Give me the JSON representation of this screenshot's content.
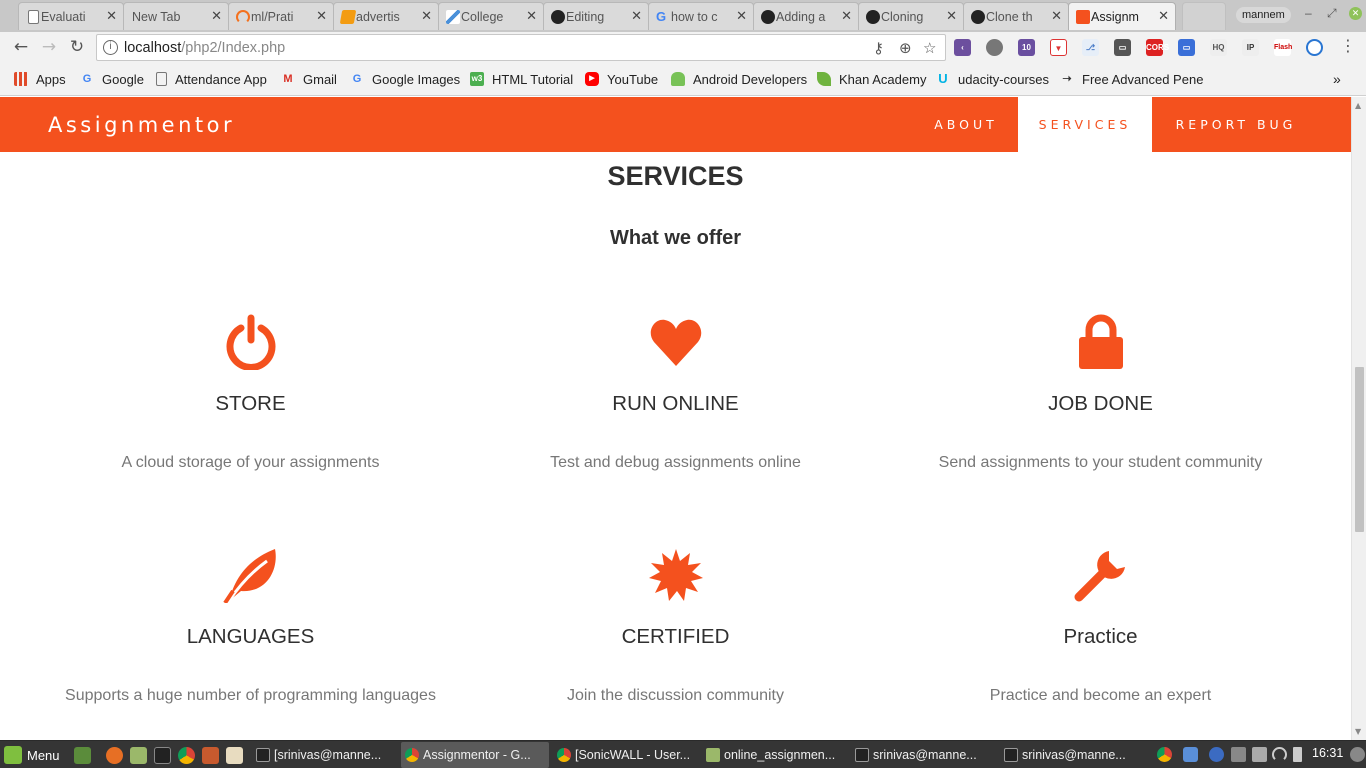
{
  "browser": {
    "tabs": [
      {
        "label": "Evaluati",
        "icon": "document-icon",
        "color": "#777777"
      },
      {
        "label": "New Tab",
        "icon": "none",
        "color": "#dadada"
      },
      {
        "label": "ml/Prati",
        "icon": "spinner-icon",
        "color": "#f4711e"
      },
      {
        "label": "advertis",
        "icon": "orange-doc-icon",
        "color": "#f39c12"
      },
      {
        "label": "College",
        "icon": "stripe-icon",
        "color": "#4a90d9"
      },
      {
        "label": "Editing",
        "icon": "github-icon",
        "color": "#222222"
      },
      {
        "label": "how to c",
        "icon": "google-icon",
        "color": "#4285f4"
      },
      {
        "label": "Adding a",
        "icon": "github-icon",
        "color": "#222222"
      },
      {
        "label": "Cloning",
        "icon": "github-icon",
        "color": "#222222"
      },
      {
        "label": "Clone th",
        "icon": "github-icon",
        "color": "#222222"
      },
      {
        "label": "Assignm",
        "icon": "xampp-icon",
        "color": "#f4511e",
        "active": true
      }
    ],
    "user_name": "mannem",
    "address": {
      "host": "localhost",
      "path": "/php2/Index.php"
    },
    "bookmarks": [
      {
        "label": "Apps",
        "icon": "apps-grid-icon",
        "color": "#e04b2a"
      },
      {
        "label": "Google",
        "icon": "google-icon",
        "color": "#4285f4"
      },
      {
        "label": "Attendance App",
        "icon": "document-icon",
        "color": "#777777"
      },
      {
        "label": "Gmail",
        "icon": "gmail-icon",
        "color": "#d93025"
      },
      {
        "label": "Google Images",
        "icon": "google-icon",
        "color": "#4285f4"
      },
      {
        "label": "HTML Tutorial",
        "icon": "w3-icon",
        "color": "#4caf50"
      },
      {
        "label": "YouTube",
        "icon": "youtube-icon",
        "color": "#ff0000"
      },
      {
        "label": "Android Developers",
        "icon": "android-icon",
        "color": "#78c257"
      },
      {
        "label": "Khan Academy",
        "icon": "leaf-icon",
        "color": "#6fb33f"
      },
      {
        "label": "udacity-courses",
        "icon": "udacity-icon",
        "color": "#02b3e4"
      },
      {
        "label": "Free Advanced Pene",
        "icon": "arrow-icon",
        "color": "#333333"
      }
    ]
  },
  "site": {
    "brand": "Assignmentor",
    "nav": [
      {
        "label": "ABOUT",
        "active": false
      },
      {
        "label": "SERVICES",
        "active": true
      },
      {
        "label": "REPORT BUG",
        "active": false
      }
    ],
    "section_title": "SERVICES",
    "section_subtitle": "What we offer",
    "services": [
      {
        "name": "STORE",
        "desc": "A cloud storage of your assignments",
        "icon": "power-icon"
      },
      {
        "name": "RUN ONLINE",
        "desc": "Test and debug assignments online",
        "icon": "heart-icon"
      },
      {
        "name": "JOB DONE",
        "desc": "Send assignments to your student community",
        "icon": "lock-icon"
      },
      {
        "name": "LANGUAGES",
        "desc": "Supports a huge number of programming languages",
        "icon": "leaf-icon"
      },
      {
        "name": "CERTIFIED",
        "desc": "Join the discussion community",
        "icon": "certificate-icon"
      },
      {
        "name": "Practice",
        "desc": "Practice and become an expert",
        "icon": "wrench-icon"
      }
    ],
    "accent_color": "#f4511e"
  },
  "taskbar": {
    "menu_label": "Menu",
    "tasks": [
      {
        "label": "[srinivas@manne...",
        "icon": "terminal-icon",
        "active": false
      },
      {
        "label": "Assignmentor - G...",
        "icon": "chrome-icon",
        "active": true
      },
      {
        "label": "[SonicWALL - User...",
        "icon": "chrome-icon",
        "active": false
      },
      {
        "label": "online_assignmen...",
        "icon": "folder-icon",
        "active": false
      },
      {
        "label": "srinivas@manne...",
        "icon": "terminal-icon",
        "active": false
      },
      {
        "label": "srinivas@manne...",
        "icon": "terminal-icon",
        "active": false
      }
    ],
    "clock": "16:31"
  }
}
